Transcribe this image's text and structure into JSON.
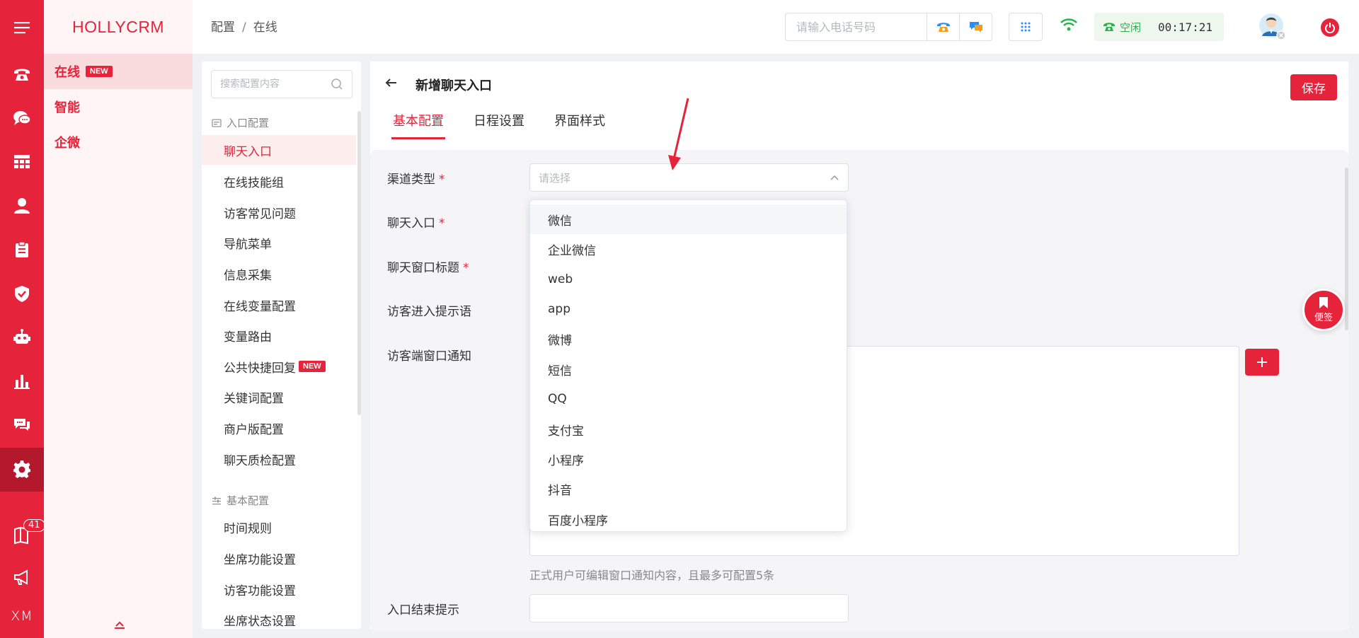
{
  "rail": {
    "items": [
      {
        "icon": "menu-icon"
      },
      {
        "icon": "phone-icon"
      },
      {
        "icon": "chat-icon"
      },
      {
        "icon": "grid-icon"
      },
      {
        "icon": "user-icon"
      },
      {
        "icon": "clipboard-icon"
      },
      {
        "icon": "shield-icon"
      },
      {
        "icon": "robot-icon"
      },
      {
        "icon": "bar-chart-icon"
      },
      {
        "icon": "message-icon"
      },
      {
        "icon": "settings-icon"
      },
      {
        "icon": "book-icon",
        "badge": "41"
      },
      {
        "icon": "megaphone-icon"
      },
      {
        "text": "XM"
      }
    ],
    "active_index": 10
  },
  "brand": "HOLLYCRM",
  "subnav": {
    "items": [
      {
        "label": "在线",
        "badge": "NEW"
      },
      {
        "label": "智能"
      },
      {
        "label": "企微"
      }
    ]
  },
  "topbar": {
    "breadcrumb": [
      "配置",
      "在线"
    ],
    "phone_placeholder": "请输入电话号码",
    "status_label": "空闲",
    "timer": "00:17:21"
  },
  "config_panel": {
    "search_placeholder": "搜索配置内容",
    "groups": [
      {
        "title": "入口配置",
        "items": [
          {
            "label": "聊天入口"
          },
          {
            "label": "在线技能组"
          },
          {
            "label": "访客常见问题"
          },
          {
            "label": "导航菜单"
          },
          {
            "label": "信息采集"
          },
          {
            "label": "在线变量配置"
          },
          {
            "label": "变量路由"
          },
          {
            "label": "公共快捷回复",
            "badge": "NEW"
          },
          {
            "label": "关键词配置"
          },
          {
            "label": "商户版配置"
          },
          {
            "label": "聊天质检配置"
          }
        ]
      },
      {
        "title": "基本配置",
        "items": [
          {
            "label": "时间规则"
          },
          {
            "label": "坐席功能设置"
          },
          {
            "label": "访客功能设置"
          },
          {
            "label": "坐席状态设置"
          }
        ]
      }
    ]
  },
  "main": {
    "title": "新增聊天入口",
    "save_label": "保存",
    "tabs": [
      "基本配置",
      "日程设置",
      "界面样式"
    ],
    "form": {
      "channel_label": "渠道类型",
      "channel_placeholder": "请选择",
      "entry_label": "聊天入口",
      "window_title_label": "聊天窗口标题",
      "welcome_label": "访客进入提示语",
      "notice_label": "访客端窗口通知",
      "notice_hint": "正式用户可编辑窗口通知内容，且最多可配置5条",
      "end_label": "入口结束提示"
    },
    "dropdown_options": [
      "微信",
      "企业微信",
      "web",
      "app",
      "微博",
      "短信",
      "QQ",
      "支付宝",
      "小程序",
      "抖音",
      "百度小程序"
    ]
  },
  "note_button_label": "便签",
  "colors": {
    "brand": "#e5233b",
    "brand_dark": "#b3182c",
    "status_green": "#2bb14e"
  }
}
